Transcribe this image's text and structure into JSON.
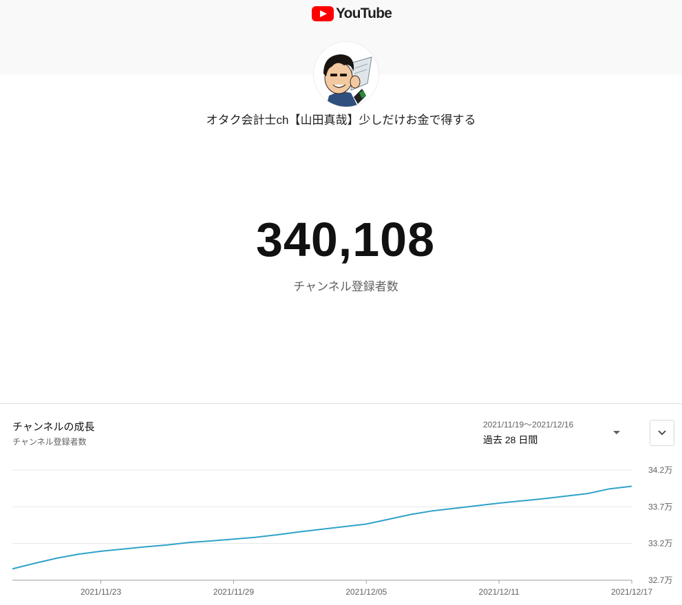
{
  "header": {
    "brand": "YouTube"
  },
  "channel": {
    "name": "オタク会計士ch【山田真哉】少しだけお金で得する"
  },
  "subscribers": {
    "count": "340,108",
    "label": "チャンネル登録者数"
  },
  "growth": {
    "title": "チャンネルの成長",
    "subtitle": "チャンネル登録者数",
    "date_range": "2021/11/19〜2021/12/16",
    "period": "過去 28 日間"
  },
  "colors": {
    "line": "#2ea2c8",
    "brand_red": "#ff0000",
    "grid": "#e6e6e6"
  },
  "icons": {
    "logo": "youtube-play-icon",
    "range": "caret-down-icon",
    "expand": "chevron-down-icon"
  },
  "chart_data": {
    "type": "line",
    "x_start": "2021/11/19",
    "x_end": "2021/12/17",
    "x_ticks": [
      "2021/11/23",
      "2021/11/29",
      "2021/12/05",
      "2021/12/11",
      "2021/12/17"
    ],
    "y_ticks": [
      "34.2万",
      "33.7万",
      "33.2万",
      "32.7万"
    ],
    "ylim": [
      327000,
      342000
    ],
    "grid": true,
    "series": [
      {
        "x": [
          "2021/11/19",
          "2021/11/20",
          "2021/11/21",
          "2021/11/22",
          "2021/11/23",
          "2021/11/24",
          "2021/11/25",
          "2021/11/26",
          "2021/11/27",
          "2021/11/28",
          "2021/11/29",
          "2021/11/30",
          "2021/12/01",
          "2021/12/02",
          "2021/12/03",
          "2021/12/04",
          "2021/12/05",
          "2021/12/06",
          "2021/12/07",
          "2021/12/08",
          "2021/12/09",
          "2021/12/10",
          "2021/12/11",
          "2021/12/12",
          "2021/12/13",
          "2021/12/14",
          "2021/12/15",
          "2021/12/16",
          "2021/12/17"
        ],
        "values": [
          328550,
          329300,
          330000,
          330550,
          330950,
          331250,
          331550,
          331800,
          332150,
          332350,
          332600,
          332850,
          333200,
          333600,
          333950,
          334300,
          334650,
          335300,
          335950,
          336450,
          336800,
          337150,
          337500,
          337800,
          338100,
          338450,
          338800,
          339450,
          339800
        ]
      }
    ]
  }
}
